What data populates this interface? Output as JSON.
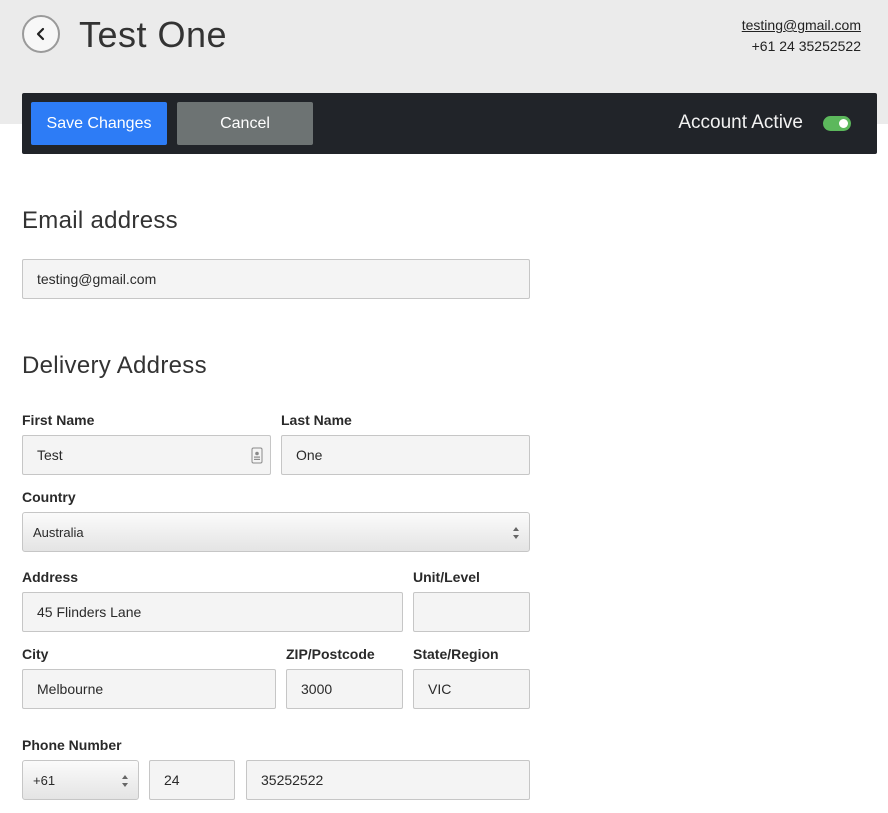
{
  "header": {
    "title": "Test One",
    "email": "testing@gmail.com",
    "phone": "+61 24 35252522"
  },
  "toolbar": {
    "save_label": "Save Changes",
    "cancel_label": "Cancel",
    "account_active_label": "Account Active",
    "account_active": true
  },
  "email_section": {
    "title": "Email address",
    "email_value": "testing@gmail.com"
  },
  "delivery": {
    "title": "Delivery Address",
    "first_name_label": "First Name",
    "first_name_value": "Test",
    "last_name_label": "Last Name",
    "last_name_value": "One",
    "country_label": "Country",
    "country_value": "Australia",
    "address_label": "Address",
    "address_value": "45 Flinders Lane",
    "unit_label": "Unit/Level",
    "unit_value": "",
    "city_label": "City",
    "city_value": "Melbourne",
    "zip_label": "ZIP/Postcode",
    "zip_value": "3000",
    "state_label": "State/Region",
    "state_value": "VIC"
  },
  "phone": {
    "label": "Phone Number",
    "country_code": "+61",
    "area_code": "24",
    "number": "35252522"
  },
  "icons": {
    "back": "chevron-left-icon",
    "contact_card": "contact-card-icon",
    "select_arrows": "select-arrows-icon"
  },
  "colors": {
    "save": "#2d7cf6",
    "cancel": "#6d7373",
    "toolbar": "#212429",
    "toggle_on": "#5cb85c"
  }
}
